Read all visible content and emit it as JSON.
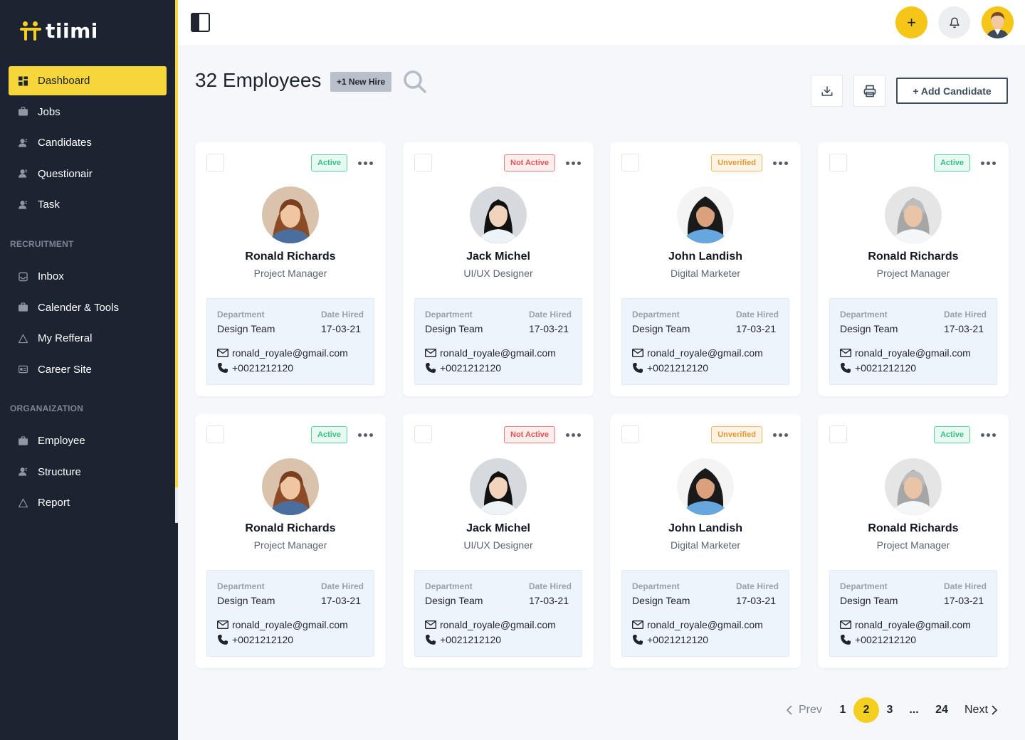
{
  "app": {
    "name": "tiimi"
  },
  "sidebar": {
    "items": [
      {
        "label": "Dashboard",
        "icon": "dashboard-icon",
        "active": true
      },
      {
        "label": "Jobs",
        "icon": "briefcase-icon"
      },
      {
        "label": "Candidates",
        "icon": "user-icon"
      },
      {
        "label": "Questionair",
        "icon": "user-icon"
      },
      {
        "label": "Task",
        "icon": "user-icon"
      }
    ],
    "section_recruitment": "RECRUITMENT",
    "recruitment_items": [
      {
        "label": "Inbox",
        "icon": "inbox-icon"
      },
      {
        "label": "Calender & Tools",
        "icon": "briefcase-icon"
      },
      {
        "label": "My Refferal",
        "icon": "triangle-icon"
      },
      {
        "label": "Career Site",
        "icon": "id-card-icon"
      }
    ],
    "section_organization": "ORGANAIZATION",
    "organization_items": [
      {
        "label": "Employee",
        "icon": "briefcase-icon"
      },
      {
        "label": "Structure",
        "icon": "user-icon"
      },
      {
        "label": "Report",
        "icon": "triangle-icon"
      }
    ]
  },
  "topbar": {
    "add_label": "+"
  },
  "header": {
    "title": "32 Employees",
    "new_hire": "+1 New Hire",
    "add_candidate": "+ Add Candidate"
  },
  "labels": {
    "department": "Department",
    "date_hired": "Date Hired"
  },
  "employees": [
    {
      "name": "Ronald Richards",
      "role": "Project Manager",
      "status": "Active",
      "department": "Design Team",
      "date_hired": "17-03-21",
      "email": "ronald_royale@gmail.com",
      "phone": "+0021212120"
    },
    {
      "name": "Jack Michel",
      "role": "UI/UX Designer",
      "status": "Not Active",
      "department": "Design Team",
      "date_hired": "17-03-21",
      "email": "ronald_royale@gmail.com",
      "phone": "+0021212120"
    },
    {
      "name": "John Landish",
      "role": "Digital Marketer",
      "status": "Unverified",
      "department": "Design Team",
      "date_hired": "17-03-21",
      "email": "ronald_royale@gmail.com",
      "phone": "+0021212120"
    },
    {
      "name": "Ronald Richards",
      "role": "Project Manager",
      "status": "Active",
      "department": "Design Team",
      "date_hired": "17-03-21",
      "email": "ronald_royale@gmail.com",
      "phone": "+0021212120"
    },
    {
      "name": "Ronald Richards",
      "role": "Project Manager",
      "status": "Active",
      "department": "Design Team",
      "date_hired": "17-03-21",
      "email": "ronald_royale@gmail.com",
      "phone": "+0021212120"
    },
    {
      "name": "Jack Michel",
      "role": "UI/UX Designer",
      "status": "Not Active",
      "department": "Design Team",
      "date_hired": "17-03-21",
      "email": "ronald_royale@gmail.com",
      "phone": "+0021212120"
    },
    {
      "name": "John Landish",
      "role": "Digital Marketer",
      "status": "Unverified",
      "department": "Design Team",
      "date_hired": "17-03-21",
      "email": "ronald_royale@gmail.com",
      "phone": "+0021212120"
    },
    {
      "name": "Ronald Richards",
      "role": "Project Manager",
      "status": "Active",
      "department": "Design Team",
      "date_hired": "17-03-21",
      "email": "ronald_royale@gmail.com",
      "phone": "+0021212120"
    }
  ],
  "pagination": {
    "prev": "Prev",
    "pages": [
      "1",
      "2",
      "3",
      "...",
      "24"
    ],
    "current": "2",
    "next": "Next"
  },
  "colors": {
    "accent": "#f6d63a",
    "sidebar_bg": "#1c2331",
    "active_status": "#3bbf8a",
    "inactive_status": "#e25353",
    "unverified_status": "#e09a3a"
  }
}
